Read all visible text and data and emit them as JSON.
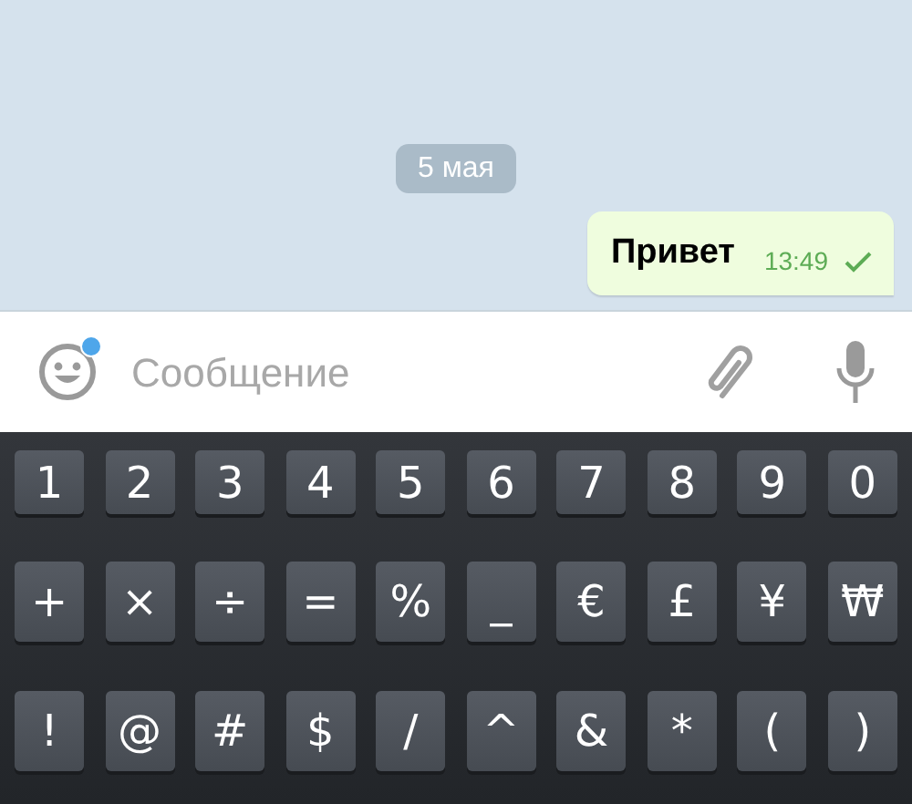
{
  "chat": {
    "date": "5 мая",
    "messages": [
      {
        "text": "Привет",
        "time": "13:49",
        "read": false
      }
    ]
  },
  "composer": {
    "placeholder": "Сообщение",
    "emoji_badge": true
  },
  "keyboard": {
    "rows": [
      {
        "keys": [
          "1",
          "2",
          "3",
          "4",
          "5",
          "6",
          "7",
          "8",
          "9",
          "0"
        ]
      },
      {
        "keys": [
          "+",
          "×",
          "÷",
          "=",
          "%",
          "_",
          "€",
          "£",
          "¥",
          "₩"
        ]
      },
      {
        "keys": [
          "!",
          "@",
          "#",
          "$",
          "/",
          "^",
          "&",
          "*",
          "(",
          ")"
        ]
      }
    ]
  }
}
